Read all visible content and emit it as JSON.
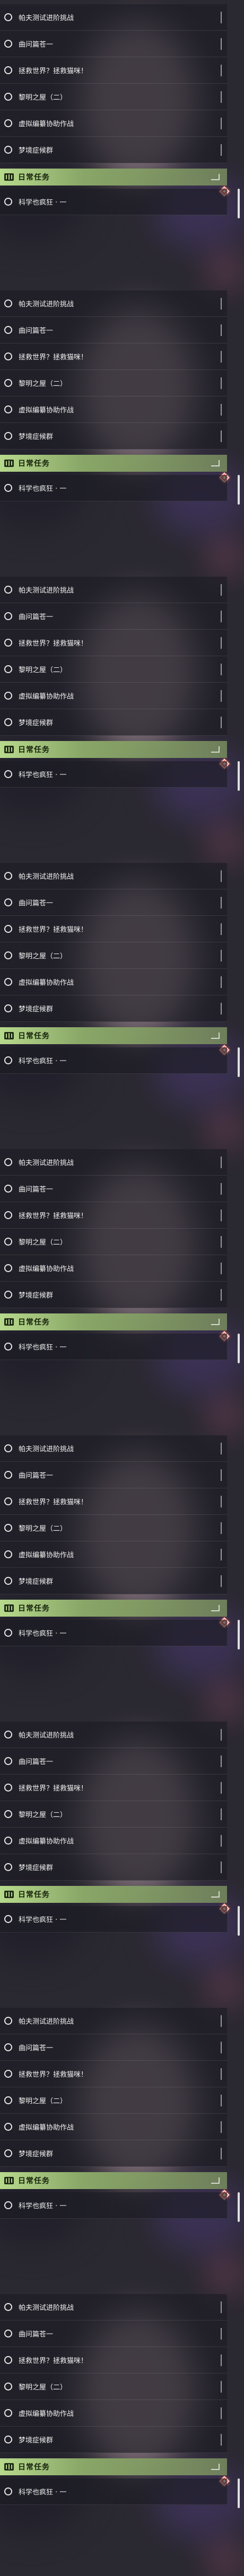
{
  "task_groups": [
    {
      "tasks": [
        "帕夫测试进阶挑战",
        "曲问篇苍一",
        "拯救世界？拯救猫咪！",
        "黎明之屋（二）",
        "虚拟编纂协助作战",
        "梦境症候群"
      ],
      "daily_header": "日常任务",
      "daily_tasks": [
        "科学也疯狂 · 一"
      ]
    },
    {
      "tasks": [
        "帕夫测试进阶挑战",
        "曲问篇苍一",
        "拯救世界？拯救猫咪！",
        "黎明之屋（二）",
        "虚拟编纂协助作战",
        "梦境症候群"
      ],
      "daily_header": "日常任务",
      "daily_tasks": [
        "科学也疯狂 · 一"
      ]
    },
    {
      "tasks": [
        "帕夫测试进阶挑战",
        "曲问篇苍一",
        "拯救世界？拯救猫咪！",
        "黎明之屋（二）",
        "虚拟编纂协助作战",
        "梦境症候群"
      ],
      "daily_header": "日常任务",
      "daily_tasks": [
        "科学也疯狂 · 一"
      ]
    },
    {
      "tasks": [
        "帕夫测试进阶挑战",
        "曲问篇苍一",
        "拯救世界？拯救猫咪！",
        "黎明之屋（二）",
        "虚拟编纂协助作战",
        "梦境症候群"
      ],
      "daily_header": "日常任务",
      "daily_tasks": [
        "科学也疯狂 · 一"
      ]
    },
    {
      "tasks": [
        "帕夫测试进阶挑战",
        "曲问篇苍一",
        "拯救世界？拯救猫咪！",
        "黎明之屋（二）",
        "虚拟编纂协助作战",
        "梦境症候群"
      ],
      "daily_header": "日常任务",
      "daily_tasks": [
        "科学也疯狂 · 一"
      ]
    },
    {
      "tasks": [
        "帕夫测试进阶挑战",
        "曲问篇苍一",
        "拯救世界？拯救猫咪！",
        "黎明之屋（二）",
        "虚拟编纂协助作战",
        "梦境症候群"
      ],
      "daily_header": "日常任务",
      "daily_tasks": [
        "科学也疯狂 · 一"
      ]
    },
    {
      "tasks": [
        "帕夫测试进阶挑战",
        "曲问篇苍一",
        "拯救世界？拯救猫咪！",
        "黎明之屋（二）",
        "虚拟编纂协助作战",
        "梦境症候群"
      ],
      "daily_header": "日常任务",
      "daily_tasks": [
        "科学也疯狂 · 一"
      ]
    },
    {
      "tasks": [
        "帕夫测试进阶挑战",
        "曲问篇苍一",
        "拯救世界？拯救猫咪！",
        "黎明之屋（二）",
        "虚拟编纂协助作战",
        "梦境症候群"
      ],
      "daily_header": "日常任务",
      "daily_tasks": [
        "科学也疯狂 · 一"
      ]
    },
    {
      "tasks": [
        "帕夫测试进阶挑战",
        "曲问篇苍一",
        "拯救世界？拯救猫咪！",
        "黎明之屋（二）",
        "虚拟编纂协助作战",
        "梦境症候群"
      ],
      "daily_header": "日常任务",
      "daily_tasks": [
        "科学也疯狂 · 一"
      ]
    }
  ],
  "icons": {
    "task_status": "circle-outline-icon",
    "daily_header": "book-icon",
    "tracking": "diamond-marker-icon"
  },
  "colors": {
    "header_accent": "#b7d98c",
    "marker": "#f06a5a",
    "row_background": "#1c1b24"
  }
}
